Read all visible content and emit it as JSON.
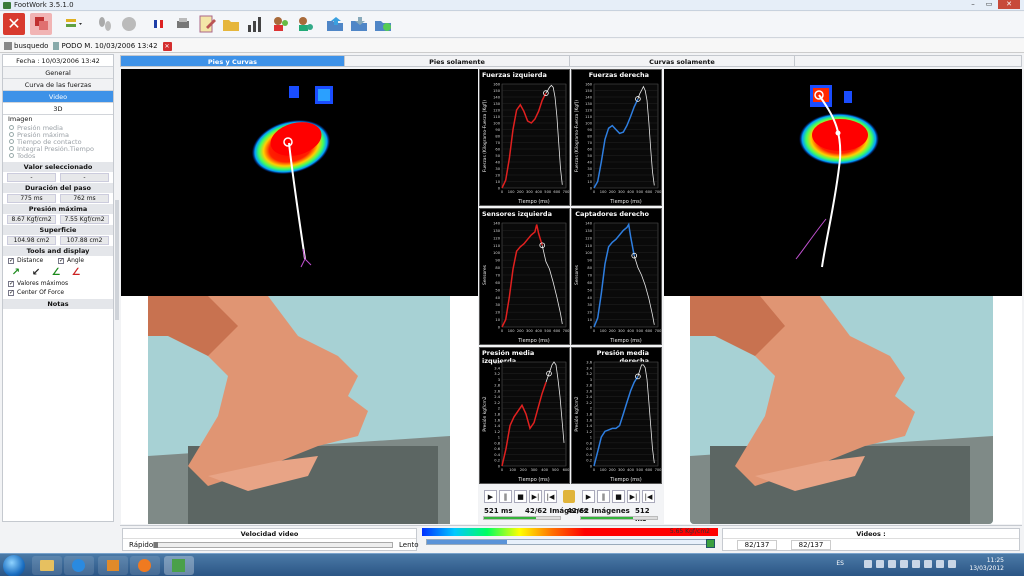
{
  "window": {
    "title": "FootWork 3.5.1.0",
    "buttons": [
      "–",
      "▭",
      "✕"
    ]
  },
  "file_tab": {
    "search_label": "busquedo",
    "patient_label": "PODO M. 10/03/2006 13:42"
  },
  "sidebar": {
    "date": "Fecha : 10/03/2006 13:42",
    "menu": [
      "General",
      "Curva de las fuerzas",
      "Video",
      "3D"
    ],
    "active_menu": "Video",
    "imagen_label": "Imagen",
    "imagen_options": [
      "Presión media",
      "Presión máxima",
      "Tiempo de contacto",
      "Integral Presión.Tiempo",
      "Todos"
    ],
    "valor_label": "Valor seleccionado",
    "valor_values": [
      "-",
      "-"
    ],
    "duracion_label": "Duración del paso",
    "duracion_values": [
      "775 ms",
      "762 ms"
    ],
    "presion_label": "Presión máxima",
    "presion_values": [
      "8.67 Kgf/cm2",
      "7.55 Kgf/cm2"
    ],
    "superficie_label": "Superficie",
    "superficie_values": [
      "104.98 cm2",
      "107.88 cm2"
    ],
    "tools_label": "Tools and display",
    "distance_label": "Distance",
    "angle_label": "Angle",
    "valores_label": "Valores máximos",
    "cof_label": "Center Of Force",
    "notas_label": "Notas"
  },
  "view_tabs": [
    "Pies y Curvas",
    "Pies solamente",
    "Curvas solamente",
    ""
  ],
  "active_view_tab": "Pies y Curvas",
  "charts": [
    {
      "title": "Fuerzas izquierda",
      "ylabel": "Fuerzas (Kilogramo-Fuerza [Kgf])",
      "xlabel": "Tiempo (ms)",
      "color": "#e0201f",
      "side": "left",
      "yticks": [
        "0",
        "10",
        "20",
        "30",
        "40",
        "50",
        "60",
        "70",
        "80",
        "90",
        "100",
        "110",
        "120",
        "130",
        "140",
        "150",
        "160"
      ],
      "xticks": [
        "0",
        "100",
        "200",
        "300",
        "400",
        "500",
        "600",
        "700"
      ]
    },
    {
      "title": "Fuerzas derecha",
      "ylabel": "Fuerzas (Kilogramo-Fuerza [Kgf])",
      "xlabel": "Tiempo (ms)",
      "color": "#2e7ee0",
      "side": "right",
      "yticks": [
        "0",
        "10",
        "20",
        "30",
        "40",
        "50",
        "60",
        "70",
        "80",
        "90",
        "100",
        "110",
        "120",
        "130",
        "140",
        "150",
        "160"
      ],
      "xticks": [
        "0",
        "100",
        "200",
        "300",
        "400",
        "500",
        "600",
        "700"
      ]
    },
    {
      "title": "Sensores izquierda",
      "ylabel": "Sensores",
      "xlabel": "Tiempo (ms)",
      "color": "#e0201f",
      "side": "left",
      "yticks": [
        "0",
        "10",
        "20",
        "30",
        "40",
        "50",
        "60",
        "70",
        "80",
        "90",
        "100",
        "110",
        "120",
        "130",
        "140"
      ],
      "xticks": [
        "0",
        "100",
        "200",
        "300",
        "400",
        "500",
        "600",
        "700"
      ]
    },
    {
      "title": "Captadores derecho",
      "ylabel": "Sensores",
      "xlabel": "Tiempo (ms)",
      "color": "#2e7ee0",
      "side": "right",
      "yticks": [
        "0",
        "10",
        "20",
        "30",
        "40",
        "50",
        "60",
        "70",
        "80",
        "90",
        "100",
        "110",
        "120",
        "130",
        "140"
      ],
      "xticks": [
        "0",
        "100",
        "200",
        "300",
        "400",
        "500",
        "600",
        "700"
      ]
    },
    {
      "title": "Presión media izquierda",
      "ylabel": "Presión kgf/cm2",
      "xlabel": "Tiempo (ms)",
      "color": "#e0201f",
      "side": "left",
      "yticks": [
        "0",
        "0.2",
        "0.4",
        "0.6",
        "0.8",
        "1",
        "1.2",
        "1.4",
        "1.6",
        "1.8",
        "2",
        "2.2",
        "2.4",
        "2.6",
        "2.8",
        "3",
        "3.2",
        "3.4",
        "3.6"
      ],
      "xticks": [
        "0",
        "100",
        "200",
        "300",
        "400",
        "500",
        "600"
      ]
    },
    {
      "title": "Presión media derecha",
      "ylabel": "Presión kgf/cm2",
      "xlabel": "Tiempo (ms)",
      "color": "#2e7ee0",
      "side": "right",
      "yticks": [
        "0",
        "0.2",
        "0.4",
        "0.6",
        "0.8",
        "1",
        "1.2",
        "1.4",
        "1.6",
        "1.8",
        "2",
        "2.2",
        "2.4",
        "2.6",
        "2.8",
        "3",
        "3.2",
        "3.4",
        "3.6"
      ],
      "xticks": [
        "0",
        "100",
        "200",
        "300",
        "400",
        "500",
        "600",
        "700"
      ]
    }
  ],
  "chart_data": [
    {
      "type": "line",
      "title": "Fuerzas izquierda",
      "xlabel": "Tiempo (ms)",
      "ylabel": "Fuerzas (Kilogramo-Fuerza [Kgf])",
      "xlim": [
        0,
        700
      ],
      "ylim": [
        0,
        160
      ],
      "series": [
        {
          "name": "",
          "x": [
            0,
            40,
            80,
            120,
            160,
            200,
            240,
            280,
            320,
            360,
            400,
            440,
            480,
            500,
            520,
            540,
            560,
            580,
            600,
            620,
            640,
            660
          ],
          "y": [
            0,
            12,
            45,
            90,
            120,
            128,
            118,
            103,
            100,
            106,
            118,
            135,
            146,
            150,
            155,
            158,
            155,
            140,
            110,
            70,
            30,
            5
          ]
        }
      ],
      "cursor_x": 480
    },
    {
      "type": "line",
      "title": "Fuerzas derecha",
      "xlabel": "Tiempo (ms)",
      "ylabel": "Fuerzas (Kilogramo-Fuerza [Kgf])",
      "xlim": [
        0,
        700
      ],
      "ylim": [
        0,
        160
      ],
      "series": [
        {
          "name": "",
          "x": [
            0,
            40,
            80,
            120,
            160,
            200,
            240,
            280,
            320,
            360,
            400,
            440,
            480,
            500,
            520,
            540,
            560,
            580,
            600,
            620,
            640,
            660
          ],
          "y": [
            0,
            10,
            40,
            75,
            92,
            96,
            90,
            84,
            86,
            96,
            110,
            125,
            137,
            145,
            150,
            156,
            150,
            135,
            100,
            60,
            25,
            4
          ]
        }
      ],
      "cursor_x": 480
    },
    {
      "type": "line",
      "title": "Sensores izquierda",
      "xlabel": "Tiempo (ms)",
      "ylabel": "Sensores",
      "xlim": [
        0,
        700
      ],
      "ylim": [
        0,
        140
      ],
      "series": [
        {
          "name": "",
          "x": [
            0,
            40,
            80,
            120,
            160,
            200,
            240,
            280,
            320,
            360,
            380,
            400,
            440,
            480,
            520,
            560,
            600,
            640,
            660
          ],
          "y": [
            0,
            10,
            40,
            78,
            102,
            108,
            112,
            118,
            124,
            128,
            138,
            126,
            110,
            88,
            78,
            60,
            40,
            18,
            4
          ]
        }
      ],
      "cursor_x": 440
    },
    {
      "type": "line",
      "title": "Captadores derecho",
      "xlabel": "Tiempo (ms)",
      "ylabel": "Sensores",
      "xlim": [
        0,
        700
      ],
      "ylim": [
        0,
        140
      ],
      "series": [
        {
          "name": "",
          "x": [
            0,
            40,
            80,
            120,
            160,
            200,
            240,
            280,
            320,
            360,
            380,
            400,
            440,
            480,
            520,
            560,
            600,
            640,
            660
          ],
          "y": [
            0,
            12,
            45,
            85,
            108,
            114,
            118,
            124,
            130,
            134,
            138,
            122,
            96,
            80,
            70,
            56,
            38,
            16,
            3
          ]
        }
      ],
      "cursor_x": 440
    },
    {
      "type": "line",
      "title": "Presión media izquierda",
      "xlabel": "Tiempo (ms)",
      "ylabel": "Presión kgf/cm2",
      "xlim": [
        0,
        640
      ],
      "ylim": [
        0,
        3.6
      ],
      "series": [
        {
          "name": "",
          "x": [
            0,
            40,
            80,
            120,
            160,
            200,
            240,
            280,
            320,
            360,
            400,
            440,
            480,
            500,
            520,
            540,
            560,
            580,
            600,
            620
          ],
          "y": [
            0,
            0.6,
            1.4,
            1.7,
            1.9,
            2.1,
            1.8,
            1.3,
            1.5,
            2.0,
            2.5,
            2.9,
            3.3,
            3.5,
            3.6,
            3.5,
            3.0,
            2.4,
            1.6,
            0.8
          ]
        }
      ],
      "cursor_x": 470
    },
    {
      "type": "line",
      "title": "Presión media derecha",
      "xlabel": "Tiempo (ms)",
      "ylabel": "Presión kgf/cm2",
      "xlim": [
        0,
        700
      ],
      "ylim": [
        0,
        3.6
      ],
      "series": [
        {
          "name": "",
          "x": [
            0,
            40,
            80,
            120,
            160,
            200,
            240,
            280,
            320,
            360,
            400,
            440,
            480,
            500,
            520,
            540,
            560,
            580,
            600,
            620,
            640,
            660
          ],
          "y": [
            0,
            0.5,
            1.0,
            1.2,
            1.25,
            1.3,
            1.3,
            1.4,
            1.8,
            2.2,
            2.6,
            2.9,
            3.1,
            3.3,
            3.5,
            3.5,
            3.4,
            3.0,
            2.2,
            1.4,
            0.6,
            0.1
          ]
        }
      ],
      "cursor_x": 480
    }
  ],
  "playback_left": {
    "time": "521 ms",
    "frames": "42/62 Imágenes",
    "progress": 0.68
  },
  "playback_right": {
    "time": "512 ms",
    "frames": "42/62 Imágenes",
    "progress": 0.68
  },
  "velocity": {
    "label": "Velocidad video",
    "fast": "Rápido",
    "slow": "Lento"
  },
  "scale_label": "5.65 Kgf/cm2",
  "scale_progress": 0.28,
  "videos": {
    "label": "Videos :",
    "left": "82/137",
    "right": "82/137"
  },
  "taskbar": {
    "lang": "ES",
    "time": "11:25",
    "date": "13/03/2012"
  },
  "colors": {
    "accent": "#3e92e8",
    "left_curve": "#e0201f",
    "right_curve": "#2e7ee0",
    "progress": "#34b33a"
  }
}
